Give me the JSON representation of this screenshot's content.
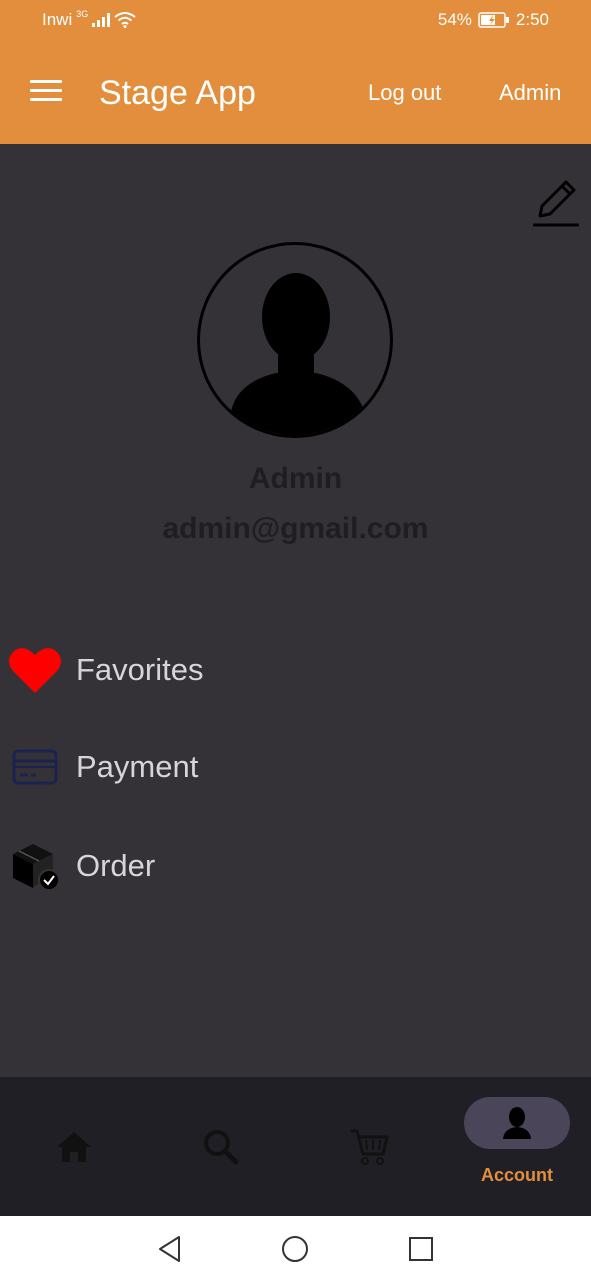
{
  "status_bar": {
    "carrier": "Inwi",
    "network": "3G",
    "battery": "54%",
    "time": "2:50"
  },
  "app_bar": {
    "menu_icon": "hamburger-menu-icon",
    "title": "Stage App",
    "logout_label": "Log out",
    "admin_label": "Admin"
  },
  "profile": {
    "edit_icon": "pencil-edit-icon",
    "avatar_icon": "person-silhouette",
    "name": "Admin",
    "email": "admin@gmail.com"
  },
  "menu": [
    {
      "label": "Favorites",
      "icon": "heart-icon"
    },
    {
      "label": "Payment",
      "icon": "credit-card-icon"
    },
    {
      "label": "Order",
      "icon": "package-icon"
    }
  ],
  "bottom_nav": {
    "items": [
      {
        "icon": "home-icon"
      },
      {
        "icon": "search-icon"
      },
      {
        "icon": "cart-icon"
      },
      {
        "icon": "account-icon",
        "label": "Account",
        "active": true
      }
    ]
  },
  "colors": {
    "accent": "#e28e3d",
    "background": "#343236",
    "nav_background": "#201f25",
    "heart": "#ff0000"
  }
}
